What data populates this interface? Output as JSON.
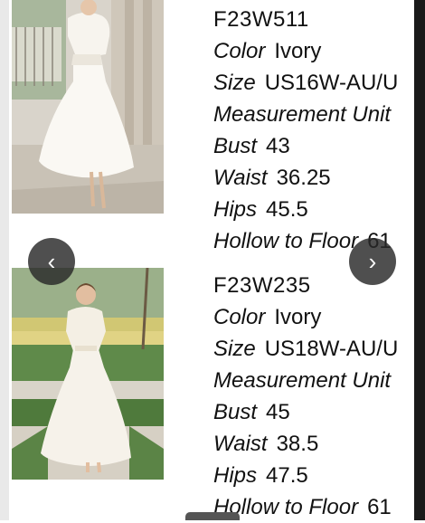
{
  "products": [
    {
      "code": "F23W511",
      "photo_alt": "",
      "fields": [
        {
          "label": "Color",
          "value": "Ivory"
        },
        {
          "label": "Size",
          "value": "US16W-AU/U"
        },
        {
          "label": "Measurement Unit",
          "value": ""
        },
        {
          "label": "Bust",
          "value": "43"
        },
        {
          "label": "Waist",
          "value": "36.25"
        },
        {
          "label": "Hips",
          "value": "45.5"
        },
        {
          "label": "Hollow to Floor",
          "value": "61"
        }
      ]
    },
    {
      "code": "F23W235",
      "photo_alt": "",
      "fields": [
        {
          "label": "Color",
          "value": "Ivory"
        },
        {
          "label": "Size",
          "value": "US18W-AU/U"
        },
        {
          "label": "Measurement Unit",
          "value": ""
        },
        {
          "label": "Bust",
          "value": "45"
        },
        {
          "label": "Waist",
          "value": "38.5"
        },
        {
          "label": "Hips",
          "value": "47.5"
        },
        {
          "label": "Hollow to Floor",
          "value": "61"
        }
      ]
    }
  ],
  "carousel": {
    "prev_icon": "‹",
    "next_icon": "›",
    "prev_icon_name": "chevron-left-icon",
    "next_icon_name": "chevron-right-icon"
  },
  "colors": {
    "text": "#111111",
    "nav_bg": "#282828",
    "frame_right": "#1a1a1a"
  }
}
